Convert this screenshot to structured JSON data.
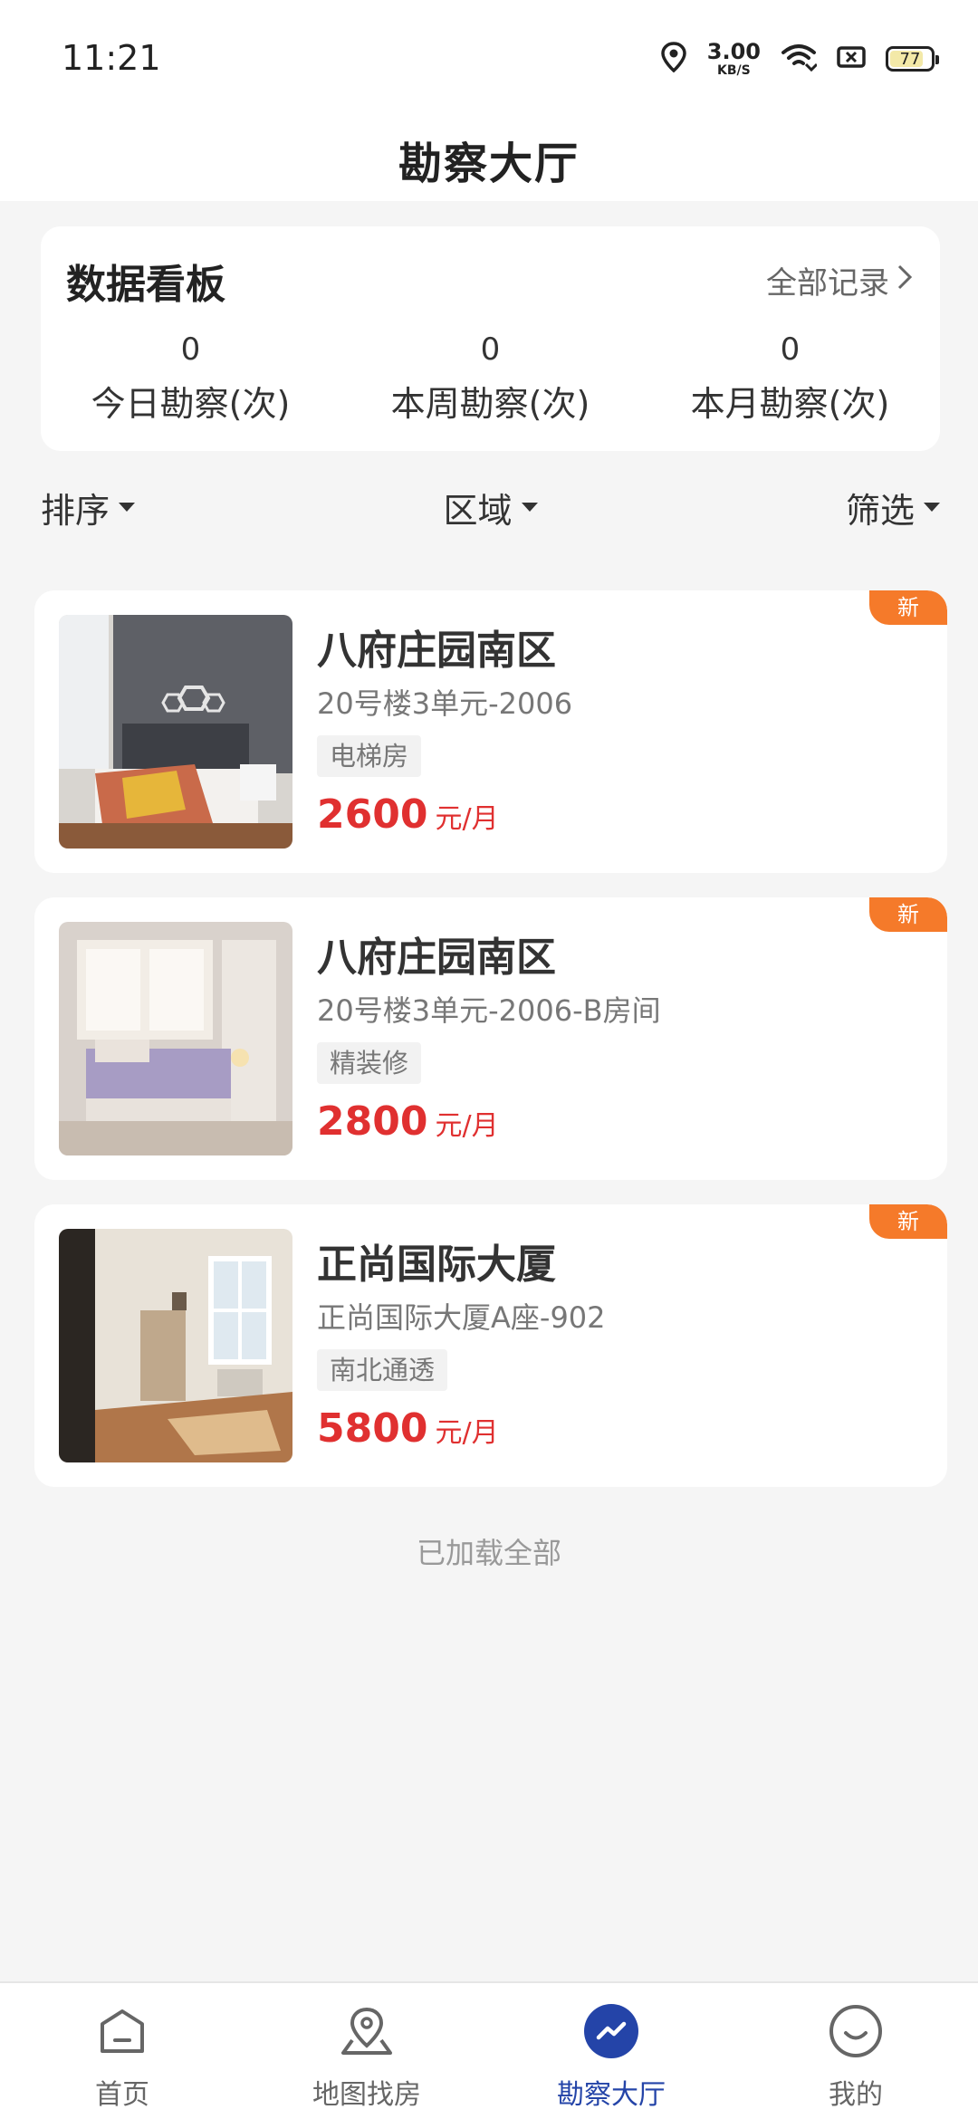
{
  "status_bar": {
    "time": "11:21",
    "net_speed_value": "3.00",
    "net_speed_unit": "KB/S",
    "battery": "77",
    "icons": [
      "location-icon",
      "wifi-icon",
      "sim-icon",
      "battery-icon"
    ]
  },
  "header": {
    "title": "勘察大厅"
  },
  "dashboard": {
    "title": "数据看板",
    "all_records_label": "全部记录",
    "stats": [
      {
        "value": "0",
        "label": "今日勘察(次)"
      },
      {
        "value": "0",
        "label": "本周勘察(次)"
      },
      {
        "value": "0",
        "label": "本月勘察(次)"
      }
    ]
  },
  "filters": {
    "sort_label": "排序",
    "area_label": "区域",
    "filter_label": "筛选"
  },
  "listings": [
    {
      "name": "八府庄园南区",
      "address": "20号楼3单元-2006",
      "tag": "电梯房",
      "price": "2600",
      "price_unit": "元/月",
      "badge": "新"
    },
    {
      "name": "八府庄园南区",
      "address": "20号楼3单元-2006-B房间",
      "tag": "精装修",
      "price": "2800",
      "price_unit": "元/月",
      "badge": "新"
    },
    {
      "name": "正尚国际大厦",
      "address": "正尚国际大厦A座-902",
      "tag": "南北通透",
      "price": "5800",
      "price_unit": "元/月",
      "badge": "新"
    }
  ],
  "load_status": "已加载全部",
  "bottom_nav": [
    {
      "label": "首页",
      "icon": "home-icon",
      "active": false
    },
    {
      "label": "地图找房",
      "icon": "map-pin-icon",
      "active": false
    },
    {
      "label": "勘察大厅",
      "icon": "trend-icon",
      "active": true
    },
    {
      "label": "我的",
      "icon": "smile-icon",
      "active": false
    }
  ],
  "colors": {
    "accent": "#2444a8",
    "price": "#e03030",
    "badge": "#f57a2a"
  }
}
